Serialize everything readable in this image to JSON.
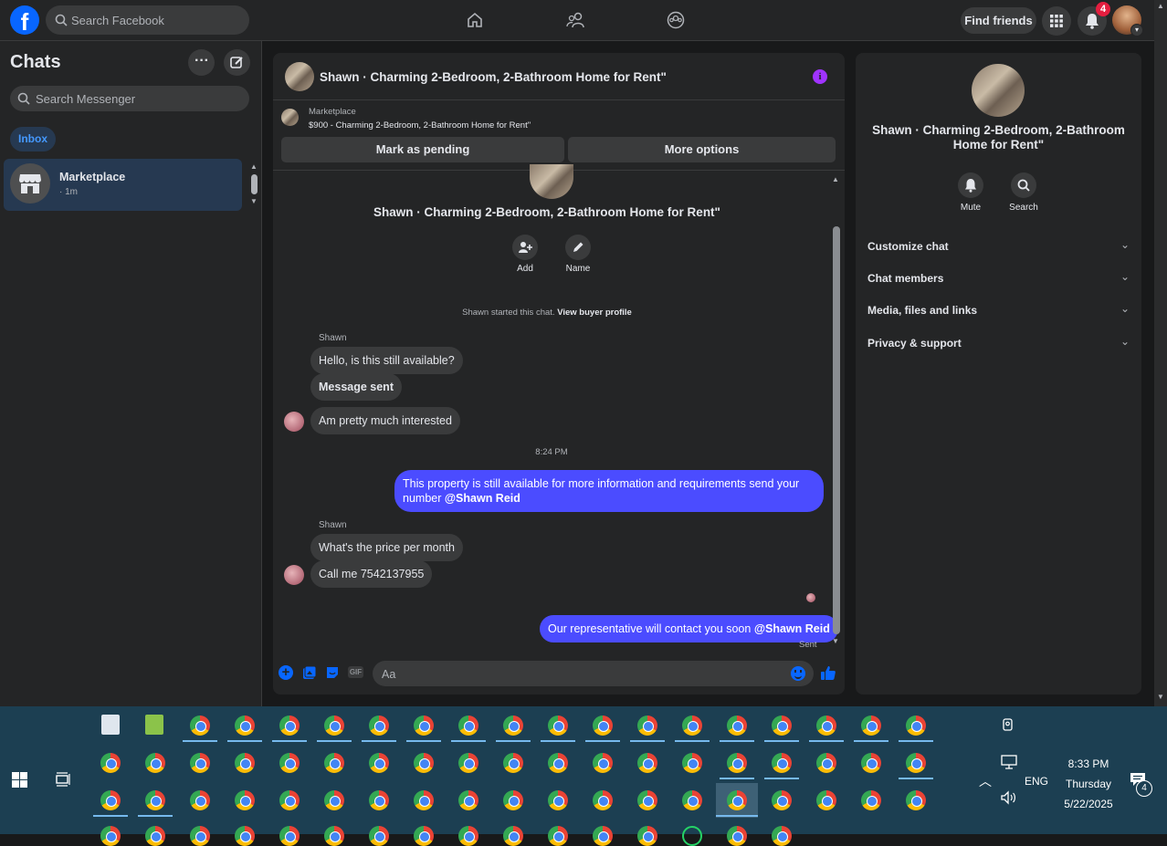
{
  "topbar": {
    "logo": "f",
    "search_placeholder": "Search Facebook",
    "find_friends": "Find friends",
    "notification_count": "4",
    "nav_icons": [
      "home-icon",
      "friends-icon",
      "groups-icon"
    ]
  },
  "sidebar": {
    "title": "Chats",
    "search_placeholder": "Search Messenger",
    "filter_inbox": "Inbox",
    "conversations": [
      {
        "name": "Marketplace",
        "meta": "· 1m"
      }
    ]
  },
  "chat": {
    "header_title": "Shawn · Charming 2-Bedroom, 2-Bathroom Home for Rent\"",
    "listing_source": "Marketplace",
    "listing_title": "$900 - Charming 2-Bedroom, 2-Bathroom Home for Rent\"",
    "mark_pending": "Mark as pending",
    "more_options": "More options",
    "intro_title": "Shawn · Charming 2-Bedroom, 2-Bathroom Home for Rent\"",
    "add_label": "Add",
    "name_label": "Name",
    "started_text": "Shawn started this chat.",
    "view_profile": "View buyer profile",
    "sender_name": "Shawn",
    "msg1": "Hello, is this still available?",
    "msg2": "Message sent",
    "msg3": "Am pretty much interested",
    "timestamp": "8:24 PM",
    "out1_text": "This property is still available for more information and requirements send your number ",
    "out1_mention": "@Shawn Reid",
    "sender_name2": "Shawn",
    "msg4": "What's the price per month",
    "msg5": "Call me 7542137955",
    "out2_text": "Our representative will contact you soon ",
    "out2_mention": "@Shawn Reid",
    "status": "Sent",
    "composer_placeholder": "Aa",
    "gif_label": "GIF"
  },
  "info": {
    "title": "Shawn · Charming 2-Bedroom, 2-Bathroom Home for Rent\"",
    "mute": "Mute",
    "search": "Search",
    "sections": [
      "Customize chat",
      "Chat members",
      "Media, files and links",
      "Privacy & support"
    ]
  },
  "taskbar": {
    "time": "8:33 PM",
    "day": "Thursday",
    "date": "5/22/2025",
    "lang": "ENG",
    "action_center_count": "4"
  },
  "colors": {
    "accent": "#0866ff",
    "outgoing_bubble": "#4b4cff",
    "background": "#18191a",
    "panel": "#242526"
  }
}
